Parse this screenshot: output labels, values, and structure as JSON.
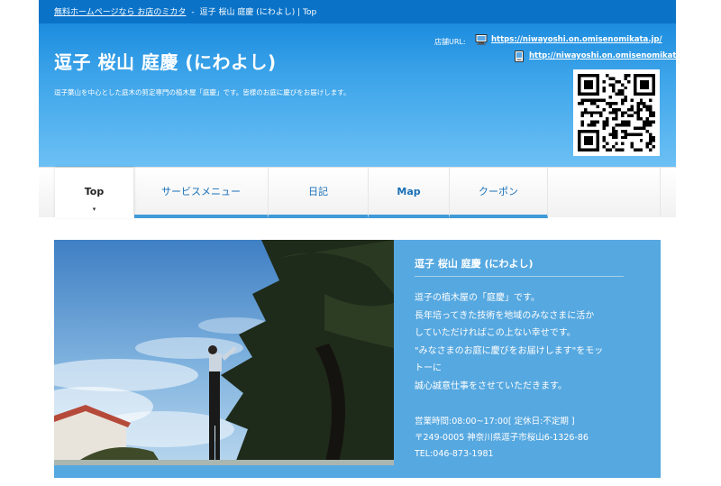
{
  "breadcrumb": {
    "link": "無料ホームページなら お店のミカタ",
    "separator": "-",
    "current": "逗子 桜山 庭慶 (にわよし) | Top"
  },
  "header": {
    "title": "逗子 桜山 庭慶 (にわよし)",
    "description": "逗子葉山を中心とした庭木の剪定専門の植木屋「庭慶」です。皆様のお庭に慶びをお届けします。",
    "url_label": "店舗URL:",
    "pc_url": "https://niwayoshi.on.omisenomikata.jp/",
    "mobile_url": "http://niwayoshi.on.omisenomikata.jp/m/"
  },
  "icons": {
    "pc": "computer-icon",
    "mobile": "mobile-phone-icon",
    "qr": "qr-code-image"
  },
  "nav": {
    "items": [
      {
        "label": "Top"
      },
      {
        "label": "サービスメニュー"
      },
      {
        "label": "日記"
      },
      {
        "label": "Map"
      },
      {
        "label": "クーポン"
      }
    ],
    "active_caret": "▾"
  },
  "hero": {
    "title": "逗子 桜山 庭慶 (にわよし)",
    "intro_lines": [
      "逗子の植木屋の「庭慶」です。",
      "長年培ってきた技術を地域のみなさまに活か",
      "していただければこの上ない幸せです。",
      "\"みなさまのお庭に慶びをお届けします\"をモッ",
      "トーに",
      "誠心誠意仕事をさせていただきます。"
    ],
    "hours": "営業時間:08:00~17:00[ 定休日:不定期 ]",
    "address": "〒249-0005 神奈川県逗子市桜山6-1326-86",
    "tel": "TEL:046-873-1981"
  },
  "colors": {
    "header_top": "#0a73c8",
    "header_bottom": "#6cc0f4",
    "nav_underline": "#3f9ad8",
    "hero_bg": "#56a8e0"
  }
}
